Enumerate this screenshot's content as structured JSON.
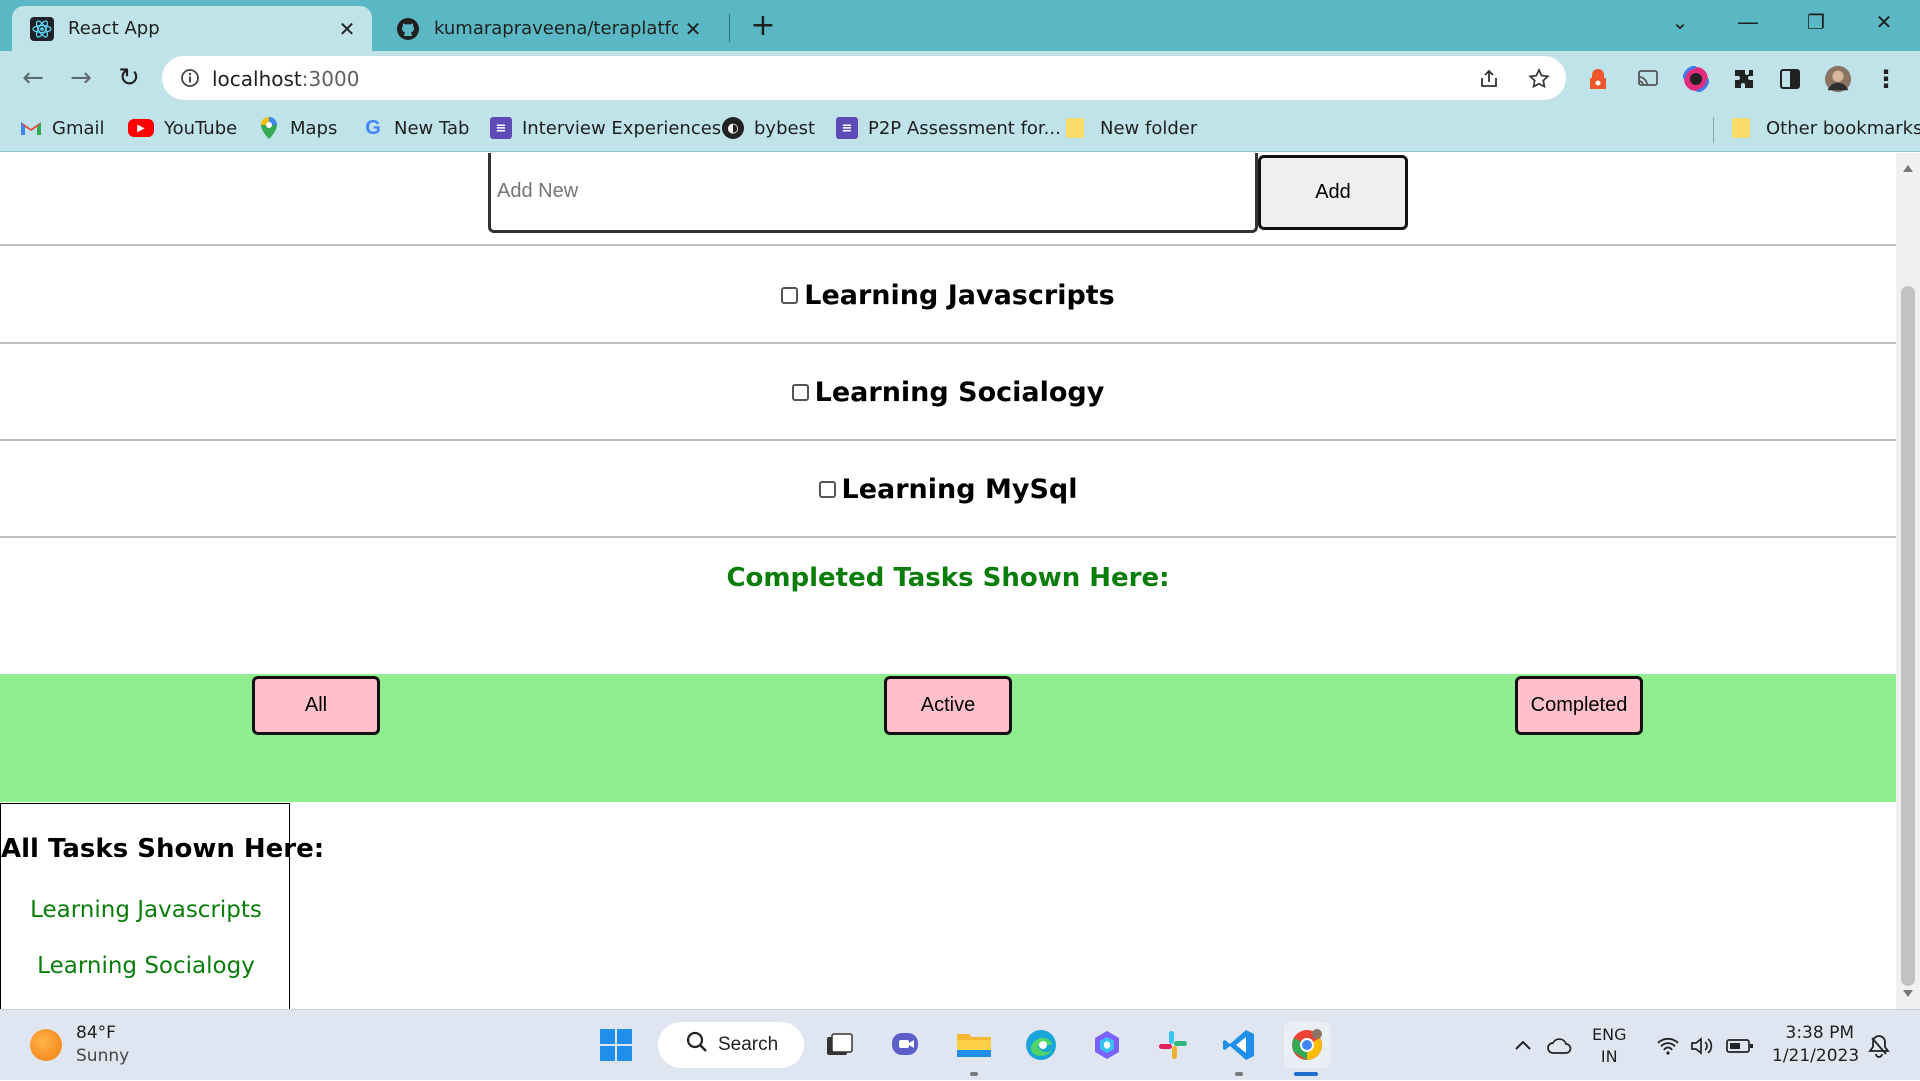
{
  "browser": {
    "tabs": [
      {
        "title": "React App",
        "icon": "react-icon",
        "active": true
      },
      {
        "title": "kumarapraveena/teraplatform",
        "icon": "github-icon",
        "active": false
      }
    ],
    "url_host": "localhost",
    "url_port": ":3000",
    "bookmarks": [
      {
        "label": "Gmail",
        "icon": "gmail-icon"
      },
      {
        "label": "YouTube",
        "icon": "youtube-icon"
      },
      {
        "label": "Maps",
        "icon": "maps-icon"
      },
      {
        "label": "New Tab",
        "icon": "google-icon"
      },
      {
        "label": "Interview Experiences",
        "icon": "forms-icon"
      },
      {
        "label": "bybest",
        "icon": "globe-icon"
      },
      {
        "label": "P2P Assessment for...",
        "icon": "forms-icon"
      },
      {
        "label": "New folder",
        "icon": "folder-icon"
      }
    ],
    "other_bookmarks": "Other bookmarks"
  },
  "app": {
    "input_placeholder": "Add New",
    "input_value": "",
    "add_label": "Add",
    "tasks": [
      {
        "label": "Learning Javascripts",
        "checked": false
      },
      {
        "label": "Learning Socialogy",
        "checked": false
      },
      {
        "label": "Learning MySql",
        "checked": false
      }
    ],
    "completed_heading": "Completed Tasks Shown Here:",
    "filters": [
      "All",
      "Active",
      "Completed"
    ],
    "all_heading": "All Tasks Shown Here:",
    "all_items": [
      "Learning Javascripts",
      "Learning Socialogy"
    ],
    "colors": {
      "completed_text": "#0a7d0a",
      "filter_bar": "#90ee90",
      "filter_button": "#ffc0cb"
    }
  },
  "taskbar": {
    "temperature": "84°F",
    "condition": "Sunny",
    "search_label": "Search",
    "lang_top": "ENG",
    "lang_bottom": "IN",
    "time": "3:38 PM",
    "date": "1/21/2023"
  }
}
